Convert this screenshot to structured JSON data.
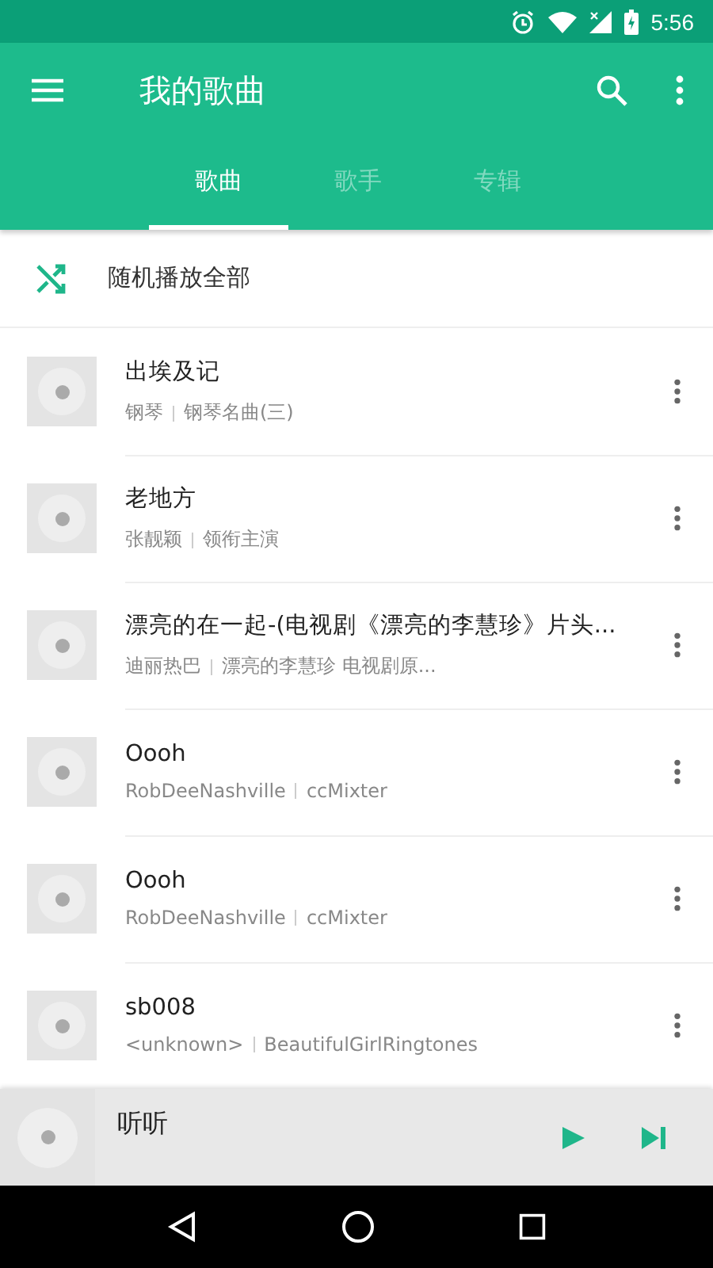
{
  "status_bar": {
    "time": "5:56"
  },
  "toolbar": {
    "title": "我的歌曲"
  },
  "tabs": [
    {
      "label": "歌曲",
      "selected": true
    },
    {
      "label": "歌手",
      "selected": false
    },
    {
      "label": "专辑",
      "selected": false
    }
  ],
  "shuffle": {
    "label": "随机播放全部"
  },
  "songs": [
    {
      "title": "出埃及记",
      "artist": "钢琴",
      "album": "钢琴名曲(三)"
    },
    {
      "title": "老地方",
      "artist": "张靓颖",
      "album": "领衔主演"
    },
    {
      "title": "漂亮的在一起-(电视剧《漂亮的李慧珍》片头...",
      "artist": "迪丽热巴",
      "album": "漂亮的李慧珍 电视剧原..."
    },
    {
      "title": "Oooh",
      "artist": "RobDeeNashville",
      "album": "ccMixter"
    },
    {
      "title": "Oooh",
      "artist": "RobDeeNashville",
      "album": "ccMixter"
    },
    {
      "title": "sb008",
      "artist": "<unknown>",
      "album": "BeautifulGirlRingtones"
    }
  ],
  "player": {
    "title": "听听"
  }
}
